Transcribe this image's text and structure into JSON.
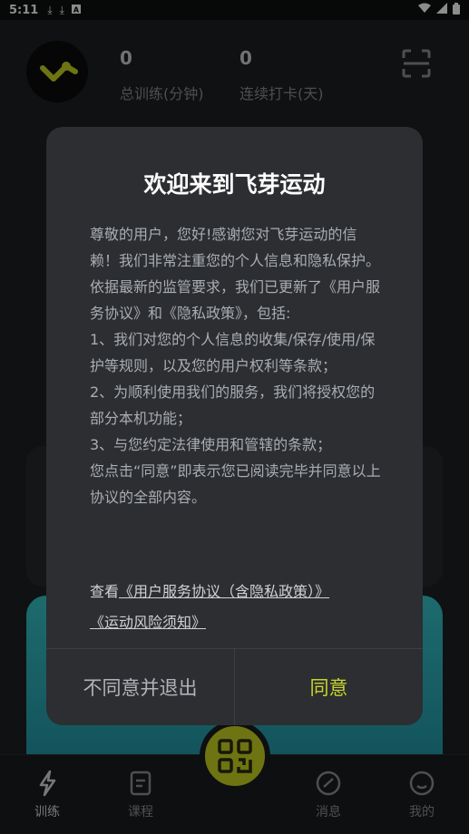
{
  "status_bar": {
    "time": "5:11",
    "left_icons": [
      "download-icon",
      "download-icon",
      "a-icon"
    ],
    "right_icons": [
      "wifi-icon",
      "signal-icon",
      "battery-icon"
    ]
  },
  "header": {
    "stats": [
      {
        "value": "0",
        "label": "总训练(分钟)"
      },
      {
        "value": "0",
        "label": "连续打卡(天)"
      }
    ]
  },
  "dialog": {
    "title": "欢迎来到飞芽运动",
    "body": "尊敬的用户，您好!感谢您对飞芽运动的信赖！我们非常注重您的个人信息和隐私保护。依据最新的监管要求，我们已更新了《用户服务协议》和《隐私政策》，包括:\n1、我们对您的个人信息的收集/保存/使用/保护等规则，以及您的用户权利等条款；\n2、为顺利使用我们的服务，我们将授权您的部分本机功能；\n3、与您约定法律使用和管辖的条款；\n您点击“同意”即表示您已阅读完毕并同意以上协议的全部内容。",
    "links_prefix": "查看",
    "link_1": "《用户服务协议（含隐私政策）》",
    "link_2": "《运动风险须知》",
    "decline": "不同意并退出",
    "agree": "同意"
  },
  "tabbar": {
    "tabs": [
      {
        "label": "训练",
        "icon": "training-icon"
      },
      {
        "label": "课程",
        "icon": "course-icon"
      },
      {
        "label": "消息",
        "icon": "message-icon"
      },
      {
        "label": "我的",
        "icon": "profile-icon"
      }
    ],
    "center_icon": "qr-code-icon"
  },
  "colors": {
    "accent": "#c9d42b",
    "dialog_bg": "#2c2e32",
    "teal": "#36c2c8"
  }
}
